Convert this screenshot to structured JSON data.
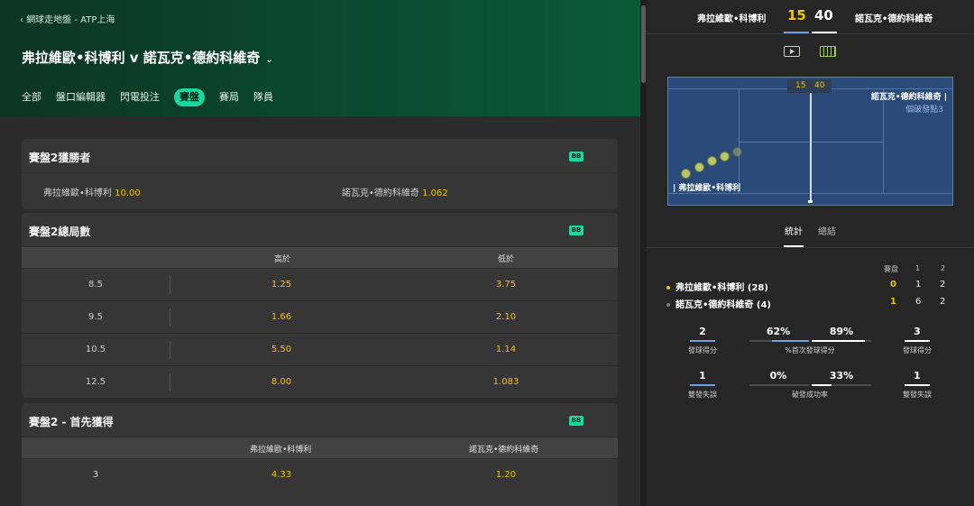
{
  "header": {
    "back_label": "網球走地盤 - ATP上海",
    "match_title": "弗拉維歐•科博利 v 諾瓦克•德約科維奇",
    "tabs": [
      "全部",
      "盤口編輯器",
      "閃電投注",
      "賽盤",
      "賽局",
      "隊員"
    ],
    "active_tab": "賽盤"
  },
  "markets": [
    {
      "title": "賽盤2獲勝者",
      "badge": "BB",
      "player1": "弗拉維歐•科博利",
      "odd1": "10.00",
      "player2": "諾瓦克•德約科維奇",
      "odd2": "1.062"
    },
    {
      "title": "賽盤2總局數",
      "badge": "BB",
      "col1": "高於",
      "col2": "低於",
      "rows": [
        {
          "line": "8.5",
          "over": "1.25",
          "under": "3.75"
        },
        {
          "line": "9.5",
          "over": "1.66",
          "under": "2.10"
        },
        {
          "line": "10.5",
          "over": "5.50",
          "under": "1.14"
        },
        {
          "line": "12.5",
          "over": "8.00",
          "under": "1.083"
        }
      ]
    },
    {
      "title": "賽盤2 - 首先獲得",
      "badge": "BB",
      "col1": "弗拉維歐•科博利",
      "col2": "諾瓦克•德約科維奇",
      "rows": [
        {
          "line": "3",
          "over": "4.33",
          "under": "1.20"
        }
      ]
    }
  ],
  "scoreboard": {
    "player1": "弗拉維歐•科博利",
    "player2": "諾瓦克•德約科維奇",
    "score1": "15",
    "score2": "40",
    "court_score1": "15",
    "court_score2": "40",
    "court_player1": "| 弗拉維歐•科博利",
    "court_player2": "諾瓦克•德約科維奇 |",
    "break_points": "個破發點3",
    "p1_color": "#6f9fe0",
    "p2_color": "#ffffff"
  },
  "stats_tabs": [
    "統計",
    "總結"
  ],
  "set_table": {
    "headers": [
      "賽盘",
      "1",
      "2"
    ],
    "rows": [
      {
        "name": "弗拉維歐•科博利 (28)",
        "current": "0",
        "s1": "1",
        "s2": "2",
        "dot": "#f3c400"
      },
      {
        "name": "諾瓦克•德約科維奇 (4)",
        "current": "1",
        "s1": "6",
        "s2": "2",
        "dot": "#7a7a7a"
      }
    ]
  },
  "stats": [
    {
      "p1": "2",
      "center_p1": "62%",
      "center_p2": "89%",
      "center_label": "%首次發球得分",
      "p1_label": "發球得分",
      "p2": "3",
      "p2_label": "發球得分",
      "p1_frac": 0.62,
      "p2_frac": 0.89
    },
    {
      "p1": "1",
      "center_p1": "0%",
      "center_p2": "33%",
      "center_label": "破發成功率",
      "p1_label": "雙發失誤",
      "p2": "1",
      "p2_label": "雙發失誤",
      "p1_frac": 0.0,
      "p2_frac": 0.33
    }
  ]
}
